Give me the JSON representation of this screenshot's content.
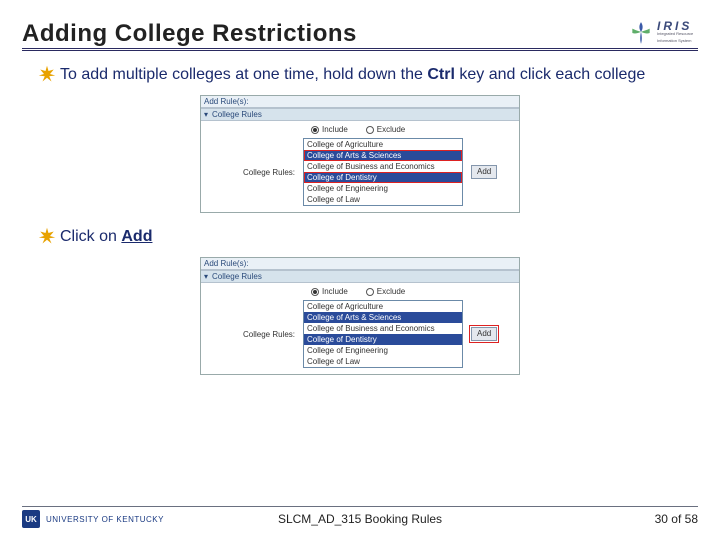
{
  "title": "Adding College Restrictions",
  "logo": {
    "brand": "IRIS",
    "sub1": "Integrated Resource",
    "sub2": "Information System"
  },
  "bullets": {
    "b1_pre": "To add multiple colleges at one time, hold down the ",
    "b1_key": "Ctrl",
    "b1_post": " key and click each college",
    "b2_pre": "Click on ",
    "b2_action": "Add"
  },
  "panel1": {
    "hdr": "Add Rule(s):",
    "sub": "College Rules",
    "radio1": "Include",
    "radio2": "Exclude",
    "label": "College Rules:",
    "options": [
      {
        "text": "College of Agriculture",
        "sel": false,
        "box": false
      },
      {
        "text": "College of Arts & Sciences",
        "sel": true,
        "box": true
      },
      {
        "text": "College of Business and Economics",
        "sel": false,
        "box": false
      },
      {
        "text": "College of Dentistry",
        "sel": true,
        "box": true
      },
      {
        "text": "College of Engineering",
        "sel": false,
        "box": false
      },
      {
        "text": "College of Law",
        "sel": false,
        "box": false
      }
    ],
    "add": "Add"
  },
  "panel2": {
    "hdr": "Add Rule(s):",
    "sub": "College Rules",
    "radio1": "Include",
    "radio2": "Exclude",
    "label": "College Rules:",
    "options": [
      {
        "text": "College of Agriculture",
        "sel": false,
        "box": false
      },
      {
        "text": "College of Arts & Sciences",
        "sel": true,
        "box": false
      },
      {
        "text": "College of Business and Economics",
        "sel": false,
        "box": false
      },
      {
        "text": "College of Dentistry",
        "sel": true,
        "box": false
      },
      {
        "text": "College of Engineering",
        "sel": false,
        "box": false
      },
      {
        "text": "College of Law",
        "sel": false,
        "box": false
      }
    ],
    "add": "Add"
  },
  "footer": {
    "uk_short": "UK",
    "uk_full": "UNIVERSITY OF KENTUCKY",
    "doc": "SLCM_AD_315 Booking Rules",
    "page": "30 of 58"
  }
}
